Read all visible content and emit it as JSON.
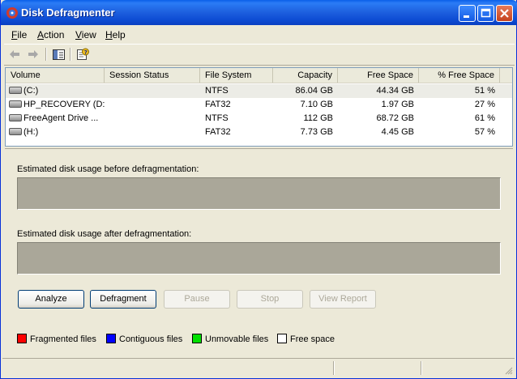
{
  "window": {
    "title": "Disk Defragmenter",
    "title_bar_color": "#0a5fe8"
  },
  "menu": {
    "items": [
      {
        "label": "File",
        "accel": "F",
        "rest": "ile"
      },
      {
        "label": "Action",
        "accel": "A",
        "rest": "ction"
      },
      {
        "label": "View",
        "accel": "V",
        "rest": "iew"
      },
      {
        "label": "Help",
        "accel": "H",
        "rest": "elp"
      }
    ]
  },
  "toolbar": {
    "icons": [
      "back-arrow-icon",
      "forward-arrow-icon",
      "show-hide-tree-icon",
      "help-properties-icon"
    ]
  },
  "volumes": {
    "columns": [
      "Volume",
      "Session Status",
      "File System",
      "Capacity",
      "Free Space",
      "% Free Space"
    ],
    "rows": [
      {
        "volume": "(C:)",
        "status": "",
        "fs": "NTFS",
        "capacity": "86.04 GB",
        "free": "44.34 GB",
        "pct": "51 %"
      },
      {
        "volume": "HP_RECOVERY (D:)",
        "status": "",
        "fs": "FAT32",
        "capacity": "7.10 GB",
        "free": "1.97 GB",
        "pct": "27 %"
      },
      {
        "volume": "FreeAgent Drive ...",
        "status": "",
        "fs": "NTFS",
        "capacity": "112 GB",
        "free": "68.72 GB",
        "pct": "61 %"
      },
      {
        "volume": "(H:)",
        "status": "",
        "fs": "FAT32",
        "capacity": "7.73 GB",
        "free": "4.45 GB",
        "pct": "57 %"
      }
    ]
  },
  "usage": {
    "before_label": "Estimated disk usage before defragmentation:",
    "after_label": "Estimated disk usage after defragmentation:"
  },
  "buttons": {
    "analyze": "Analyze",
    "defragment": "Defragment",
    "pause": "Pause",
    "stop": "Stop",
    "view_report": "View Report"
  },
  "legend": {
    "items": [
      {
        "label": "Fragmented files",
        "color": "#ff0000"
      },
      {
        "label": "Contiguous files",
        "color": "#0000ff"
      },
      {
        "label": "Unmovable files",
        "color": "#00e000"
      },
      {
        "label": "Free space",
        "color": "#ffffff"
      }
    ]
  }
}
